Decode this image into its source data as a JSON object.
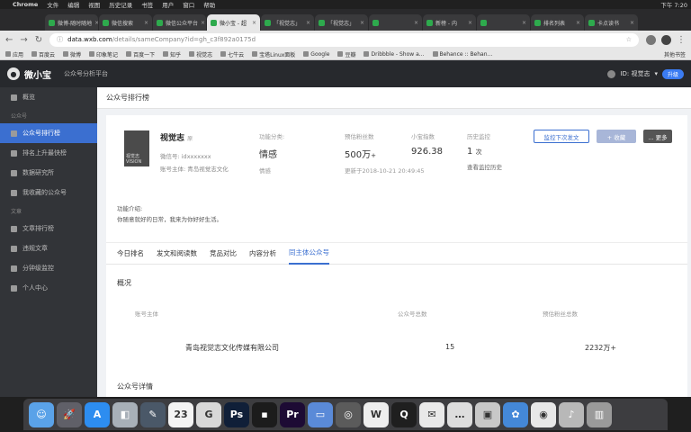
{
  "menubar": {
    "apple": "",
    "app": "Chrome",
    "items": [
      "文件",
      "编辑",
      "视图",
      "历史记录",
      "书签",
      "用户",
      "窗口",
      "帮助"
    ],
    "clock": "下午 7:20"
  },
  "tabs": [
    {
      "label": "微博-随时随地",
      "active": false
    },
    {
      "label": "微信搜索",
      "active": false
    },
    {
      "label": "微信公众平台",
      "active": false
    },
    {
      "label": "微小宝 - 超",
      "active": true
    },
    {
      "label": "「视觉志」",
      "active": false
    },
    {
      "label": "「视觉志」",
      "active": false
    },
    {
      "label": "",
      "active": false
    },
    {
      "label": "新榜 - 内",
      "active": false
    },
    {
      "label": "",
      "active": false
    },
    {
      "label": "排名列表",
      "active": false
    },
    {
      "label": "卡点读书",
      "active": false
    }
  ],
  "url": {
    "host": "data.wxb.com",
    "path": "/details/sameCompany?id=gh_c3f892a0175d"
  },
  "bookmarks": [
    "应用",
    "百度云",
    "微博",
    "印象笔记",
    "百度一下",
    "知乎",
    "视觉志",
    "七牛云",
    "宝塔Linux面板",
    "Google",
    "豆瓣",
    "Dribbble - Show a...",
    "Behance :: Behan..."
  ],
  "bookmarks_more": "其他书签",
  "app": {
    "logo_text": "微小宝",
    "subtitle": "公众号分析平台",
    "user": "ID: 视觉志",
    "upgrade": "升级"
  },
  "sidebar": {
    "items": [
      {
        "type": "item",
        "label": "概览",
        "active": false
      },
      {
        "type": "group",
        "label": "公众号"
      },
      {
        "type": "item",
        "label": "公众号排行榜",
        "active": true
      },
      {
        "type": "item",
        "label": "排名上升最快榜",
        "active": false
      },
      {
        "type": "item",
        "label": "数据研究所",
        "active": false
      },
      {
        "type": "item",
        "label": "我收藏的公众号",
        "active": false
      },
      {
        "type": "group",
        "label": "文章"
      },
      {
        "type": "item",
        "label": "文章排行榜",
        "active": false
      },
      {
        "type": "item",
        "label": "违规文章",
        "active": false
      },
      {
        "type": "item",
        "label": "分钟级监控",
        "active": false
      },
      {
        "type": "item",
        "label": "个人中心",
        "active": false
      }
    ]
  },
  "page_title": "公众号排行榜",
  "profile": {
    "cover_text": "视觉志 VISION",
    "name": "视觉志",
    "tag": "原",
    "wechat_id": "微信号: idxxxxxxx",
    "subject": "账号主体: 青岛视觉志文化"
  },
  "stats": [
    {
      "label": "功能分类:",
      "value": "情感",
      "unit": "",
      "sub": "情感"
    },
    {
      "label": "预估粉丝数",
      "value": "500万",
      "unit": "+",
      "sub": "更新于2018-10-21 20:49:45"
    },
    {
      "label": "小宝指数",
      "value": "926.38",
      "unit": "",
      "sub": ""
    },
    {
      "label": "历史监控",
      "value": "1",
      "unit": "次",
      "sub": "查看监控历史"
    }
  ],
  "buttons": {
    "monitor": "监控下次发文",
    "add": "+ 收藏",
    "more": "... 更多"
  },
  "intro": {
    "label": "功能介绍:",
    "text": "你随意就好的日常，我来为你好好生活。"
  },
  "content_tabs": [
    {
      "label": "今日排名",
      "active": false
    },
    {
      "label": "发文和阅读数",
      "active": false
    },
    {
      "label": "竞品对比",
      "active": false
    },
    {
      "label": "内容分析",
      "active": false
    },
    {
      "label": "同主体公众号",
      "active": true
    }
  ],
  "overview": {
    "title": "概况",
    "headers": [
      "账号主体",
      "公众号总数",
      "预估粉丝总数"
    ],
    "row": {
      "company": "青岛视觉志文化传媒有限公司",
      "count": "15",
      "fans": "2232万+"
    }
  },
  "details_title": "公众号详情",
  "dock": [
    {
      "icon": "finder-icon",
      "color": "#5aa2e8",
      "glyph": "☺"
    },
    {
      "icon": "launchpad-icon",
      "color": "#606068",
      "glyph": "🚀"
    },
    {
      "icon": "appstore-icon",
      "color": "#2d8df0",
      "glyph": "A"
    },
    {
      "icon": "preview-icon",
      "color": "#a8b0b8",
      "glyph": "◧"
    },
    {
      "icon": "xcode-icon",
      "color": "#4a5868",
      "glyph": "✎"
    },
    {
      "icon": "calendar-icon",
      "color": "#f4f4f4",
      "glyph": "23"
    },
    {
      "icon": "spotlight-icon",
      "color": "#d8d8d8",
      "glyph": "G"
    },
    {
      "icon": "photoshop-icon",
      "color": "#101f38",
      "glyph": "Ps"
    },
    {
      "icon": "illustrator-icon",
      "color": "#1c1c1c",
      "glyph": "▪"
    },
    {
      "icon": "premiere-icon",
      "color": "#1d0b34",
      "glyph": "Pr"
    },
    {
      "icon": "keynote-icon",
      "color": "#5a8ad8",
      "glyph": "▭"
    },
    {
      "icon": "safari-icon",
      "color": "#5b5b5b",
      "glyph": "◎"
    },
    {
      "icon": "wps-icon",
      "color": "#eeeeee",
      "glyph": "W"
    },
    {
      "icon": "qq-icon",
      "color": "#1f1f1f",
      "glyph": "Q"
    },
    {
      "icon": "wechat-icon",
      "color": "#e9e9e9",
      "glyph": "✉"
    },
    {
      "icon": "messages-icon",
      "color": "#dddddd",
      "glyph": "…"
    },
    {
      "icon": "screenshot-icon",
      "color": "#c8c8c8",
      "glyph": "▣"
    },
    {
      "icon": "photos-icon",
      "color": "#4488d8",
      "glyph": "✿"
    },
    {
      "icon": "chrome-icon",
      "color": "#e8e8e8",
      "glyph": "◉"
    },
    {
      "icon": "music-icon",
      "color": "#b8b8b8",
      "glyph": "♪"
    },
    {
      "icon": "trash-icon",
      "color": "#9a9a9a",
      "glyph": "▥"
    }
  ]
}
